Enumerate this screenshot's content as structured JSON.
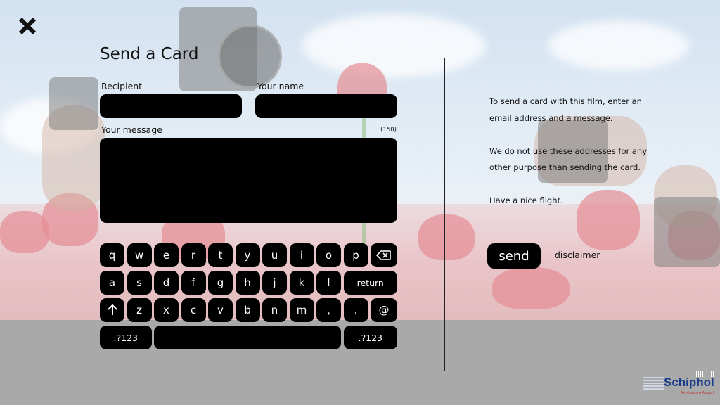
{
  "card": {
    "title": "Send a Card",
    "recipient_label": "Recipient",
    "name_label": "Your name",
    "message_label": "Your message",
    "char_count": "(150)"
  },
  "keyboard": {
    "row1": [
      "q",
      "w",
      "e",
      "r",
      "t",
      "y",
      "u",
      "i",
      "o",
      "p"
    ],
    "backspace_icon": "backspace-icon",
    "row2": [
      "a",
      "s",
      "d",
      "f",
      "g",
      "h",
      "j",
      "k",
      "l"
    ],
    "return_label": "return",
    "shift_icon": "shift-arrow-icon",
    "row3": [
      "z",
      "x",
      "c",
      "v",
      "b",
      "n",
      "m",
      ",",
      ".",
      "@"
    ],
    "symbols_label": ".?123"
  },
  "info": {
    "line1": "To send a card with this film, enter an email address and a message.",
    "line2": "We do not use these addresses for any other purpose than sending the card.",
    "line3": "Have a nice flight."
  },
  "actions": {
    "send_label": "send",
    "disclaimer_label": "disclaimer"
  },
  "brand": {
    "name": "Schiphol",
    "tagline": "Amsterdam Airport"
  },
  "colors": {
    "key_bg": "#000000",
    "page_bg": "#a9a9a9",
    "brand_blue": "#1a3c8c"
  }
}
